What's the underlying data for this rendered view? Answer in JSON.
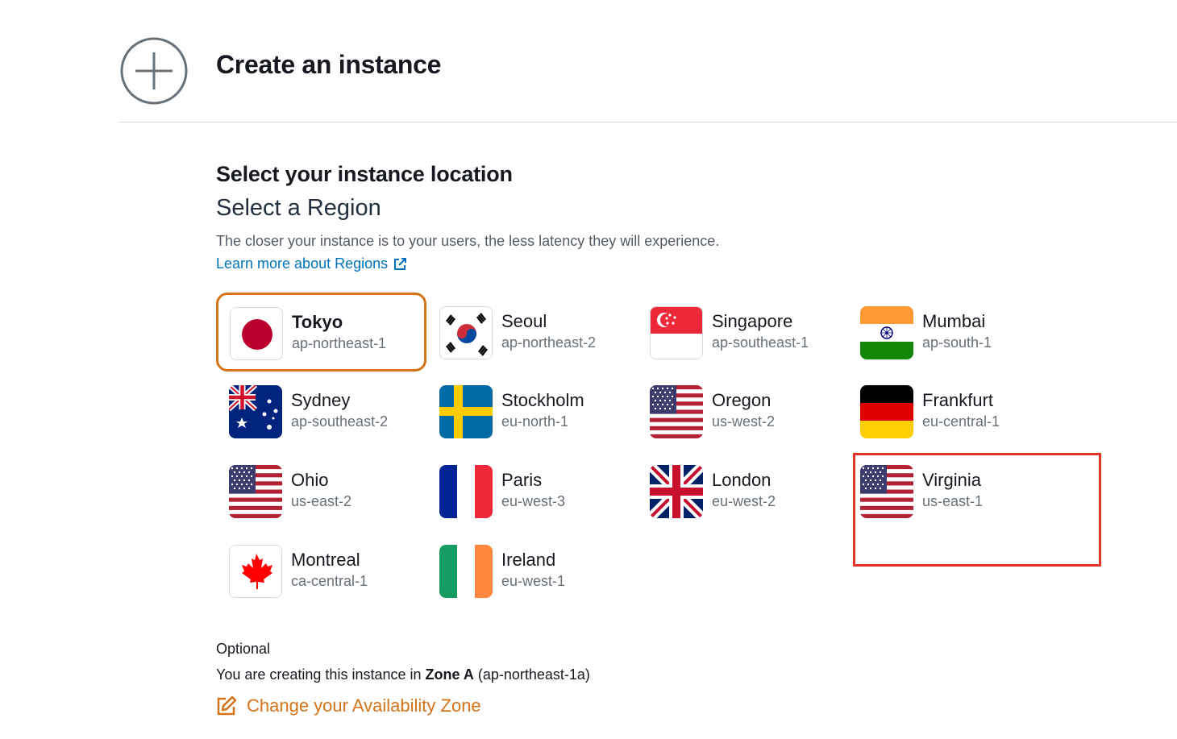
{
  "header": {
    "icon": "plus-circle-icon",
    "title": "Create an instance"
  },
  "location": {
    "title": "Select your instance location",
    "region_heading": "Select a Region",
    "description": "The closer your instance is to your users, the less latency they will experience.",
    "learn_more": "Learn more about Regions",
    "learn_more_icon": "external-link-icon"
  },
  "regions": [
    {
      "name": "Tokyo",
      "code": "ap-northeast-1",
      "flag": "japan-flag-icon",
      "selected": true
    },
    {
      "name": "Seoul",
      "code": "ap-northeast-2",
      "flag": "south-korea-flag-icon"
    },
    {
      "name": "Singapore",
      "code": "ap-southeast-1",
      "flag": "singapore-flag-icon"
    },
    {
      "name": "Mumbai",
      "code": "ap-south-1",
      "flag": "india-flag-icon"
    },
    {
      "name": "Sydney",
      "code": "ap-southeast-2",
      "flag": "australia-flag-icon"
    },
    {
      "name": "Stockholm",
      "code": "eu-north-1",
      "flag": "sweden-flag-icon"
    },
    {
      "name": "Oregon",
      "code": "us-west-2",
      "flag": "usa-flag-icon"
    },
    {
      "name": "Frankfurt",
      "code": "eu-central-1",
      "flag": "germany-flag-icon"
    },
    {
      "name": "Ohio",
      "code": "us-east-2",
      "flag": "usa-flag-icon"
    },
    {
      "name": "Paris",
      "code": "eu-west-3",
      "flag": "france-flag-icon"
    },
    {
      "name": "London",
      "code": "eu-west-2",
      "flag": "uk-flag-icon"
    },
    {
      "name": "Virginia",
      "code": "us-east-1",
      "flag": "usa-flag-icon"
    },
    {
      "name": "Montreal",
      "code": "ca-central-1",
      "flag": "canada-flag-icon"
    },
    {
      "name": "Ireland",
      "code": "eu-west-1",
      "flag": "ireland-flag-icon"
    }
  ],
  "zone": {
    "optional_label": "Optional",
    "text_prefix": "You are creating this instance in ",
    "zone_name": "Zone A",
    "zone_suffix": " (ap-northeast-1a)",
    "change_label": "Change your Availability Zone",
    "change_icon": "edit-icon"
  },
  "colors": {
    "accent": "#d57318",
    "link": "#0073bb",
    "highlight": "#e53528"
  }
}
